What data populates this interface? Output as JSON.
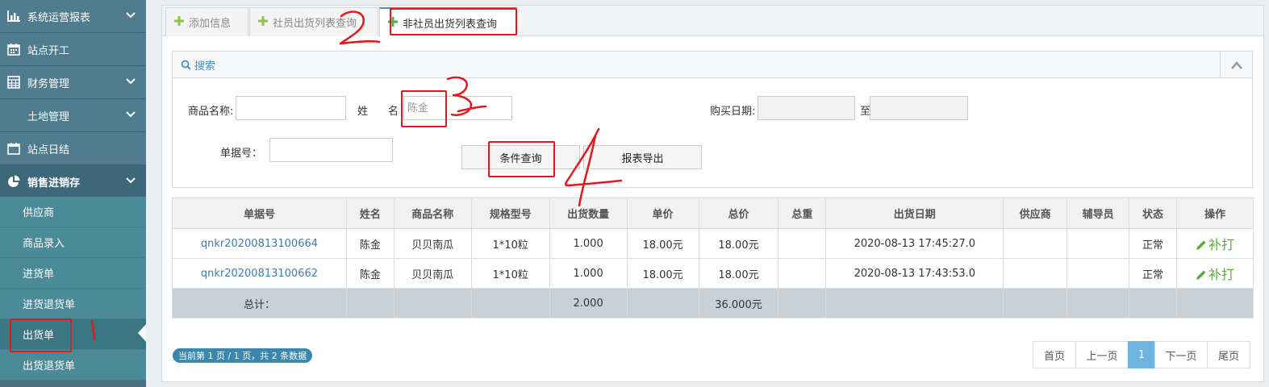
{
  "sidebar": {
    "items": [
      {
        "label": "系统运营报表",
        "icon": "bar-chart-icon",
        "expandable": true
      },
      {
        "label": "站点开工",
        "icon": "calendar-icon",
        "expandable": false
      },
      {
        "label": "财务管理",
        "icon": "table-icon",
        "expandable": true
      },
      {
        "label": "土地管理",
        "icon": "",
        "expandable": true
      },
      {
        "label": "站点日结",
        "icon": "calendar-blank-icon",
        "expandable": false
      },
      {
        "label": "销售进销存",
        "icon": "pie-chart-icon",
        "expandable": true
      }
    ],
    "subitems": [
      "供应商",
      "商品录入",
      "进货单",
      "进货退货单",
      "出货单",
      "出货退货单"
    ],
    "current_subitem": "出货单"
  },
  "tabs": [
    {
      "label": "添加信息",
      "active": false
    },
    {
      "label": "社员出货列表查询",
      "active": false
    },
    {
      "label": "非社员出货列表查询",
      "active": true
    }
  ],
  "search": {
    "title": "搜索",
    "product_name_label": "商品名称:",
    "product_name_value": "",
    "surname_label": "姓",
    "name_label": "名",
    "name_placeholder": "陈金",
    "purchase_date_label": "购买日期:",
    "date_from": "",
    "to_label": "至",
    "date_to": "",
    "doc_no_label": "单据号：",
    "doc_no_value": "",
    "query_button": "条件查询",
    "export_button": "报表导出"
  },
  "table": {
    "headers": [
      "单据号",
      "姓名",
      "商品名称",
      "规格型号",
      "出货数量",
      "单价",
      "总价",
      "总重",
      "出货日期",
      "供应商",
      "辅导员",
      "状态",
      "操作"
    ],
    "rows": [
      [
        "qnkr20200813100664",
        "陈金",
        "贝贝南瓜",
        "1*10粒",
        "1.000",
        "18.00元",
        "18.00元",
        "",
        "2020-08-13 17:45:27.0",
        "",
        "",
        "正常",
        "补打"
      ],
      [
        "qnkr20200813100662",
        "陈金",
        "贝贝南瓜",
        "1*10粒",
        "1.000",
        "18.00元",
        "18.00元",
        "",
        "2020-08-13 17:43:53.0",
        "",
        "",
        "正常",
        "补打"
      ]
    ],
    "total_label": "总计：",
    "total_qty": "2.000",
    "total_price": "36.000元"
  },
  "footer": {
    "page_info": "当前第 1 页 / 1 页，共 2 条数据",
    "pager": [
      "首页",
      "上一页",
      "1",
      "下一页",
      "尾页"
    ],
    "current_page": "1"
  },
  "colors": {
    "sidebar": "#4f7c8f",
    "submenu": "#4b8b98",
    "accent": "#4a8ec2",
    "link": "#3a7cb7",
    "action": "#5aab3a",
    "annotation": "#e5171d"
  }
}
